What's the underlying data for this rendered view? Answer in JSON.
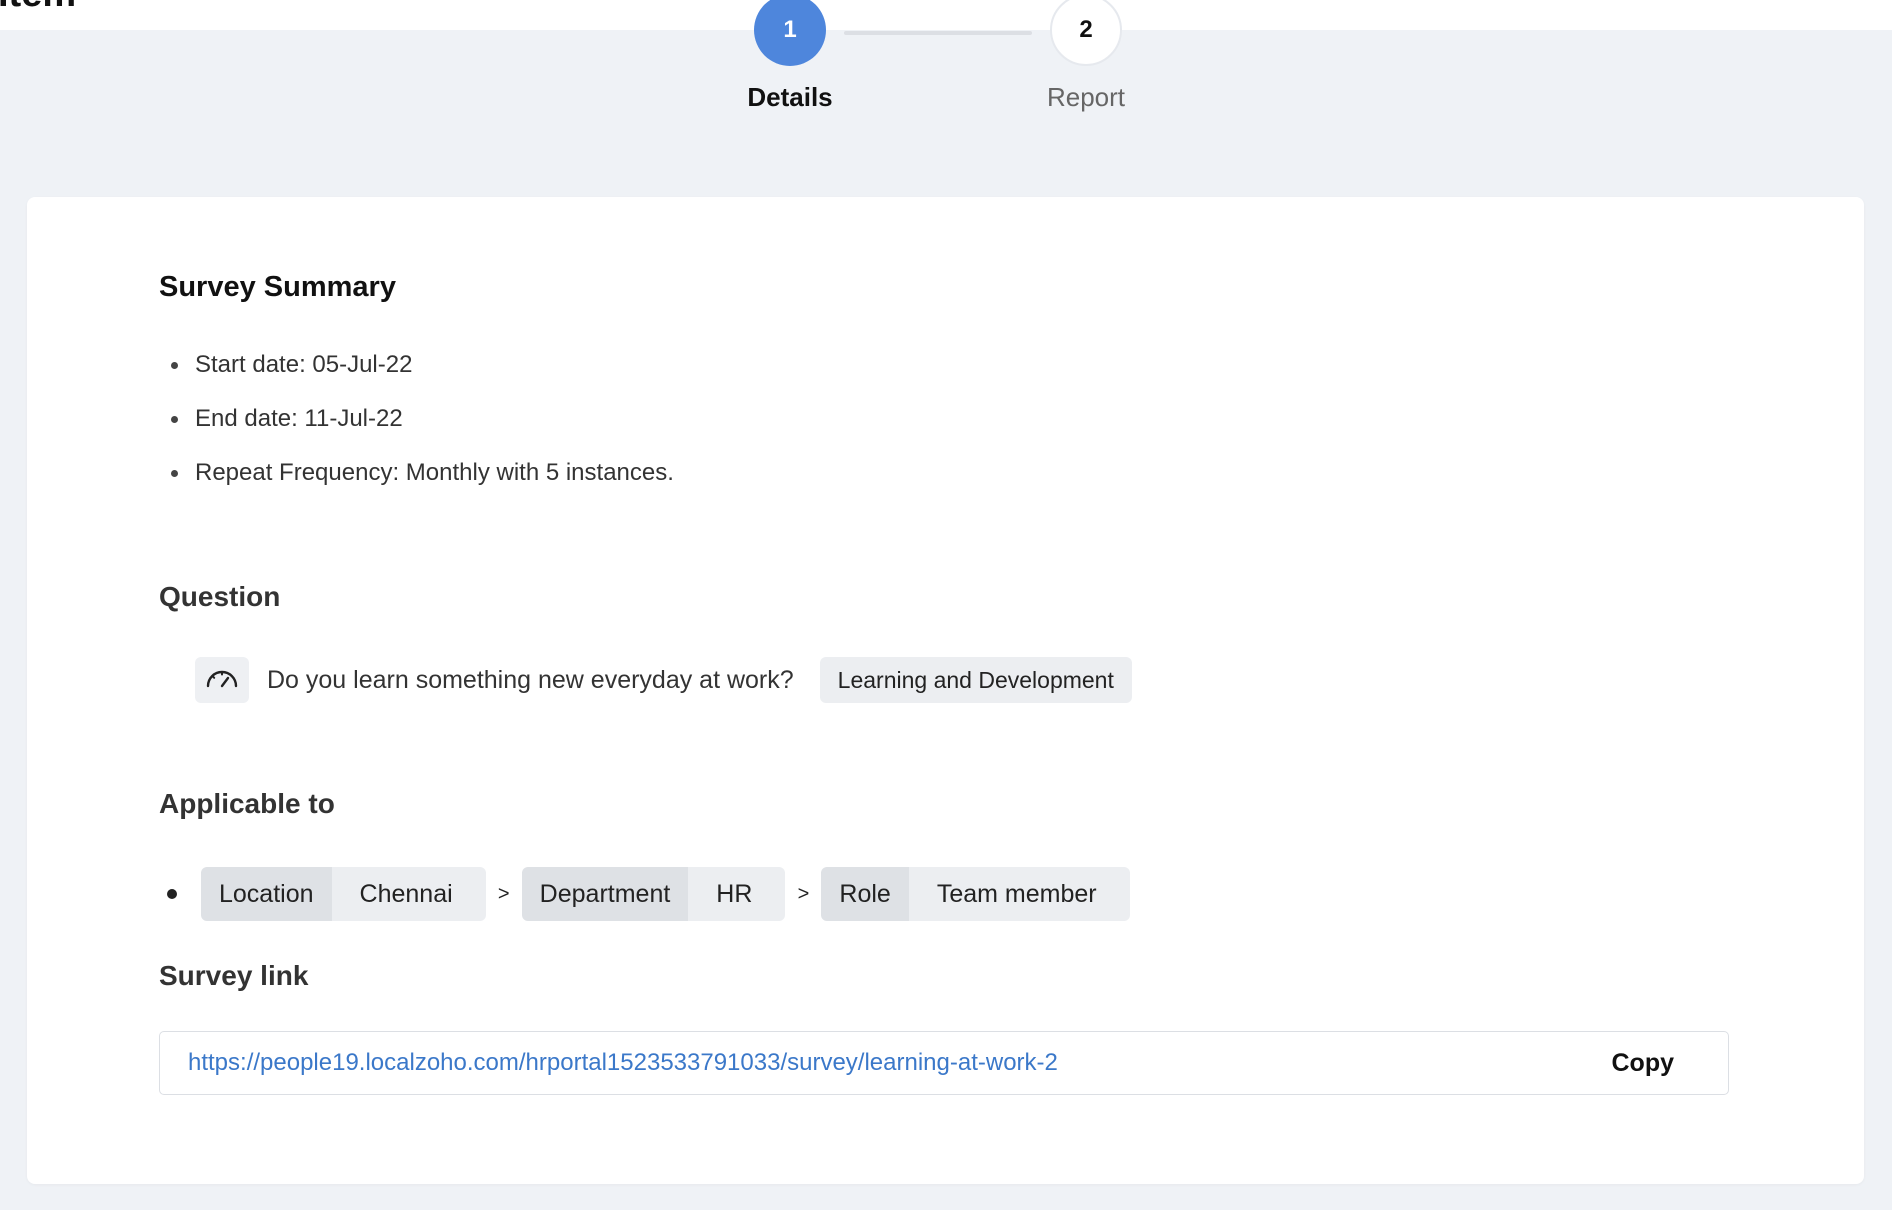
{
  "header": {
    "title": "Item"
  },
  "stepper": {
    "steps": [
      {
        "number": "1",
        "label": "Details"
      },
      {
        "number": "2",
        "label": "Report"
      }
    ]
  },
  "summary": {
    "title": "Survey Summary",
    "items": [
      "Start date: 05-Jul-22",
      "End date: 11-Jul-22",
      "Repeat Frequency: Monthly with 5 instances."
    ]
  },
  "question": {
    "title": "Question",
    "icon": "gauge-icon",
    "text": "Do you learn something new everyday at work?",
    "tag": "Learning and Development"
  },
  "applicable": {
    "title": "Applicable to",
    "separator": ">",
    "criteria": [
      {
        "key": "Location",
        "value": "Chennai"
      },
      {
        "key": "Department",
        "value": "HR"
      },
      {
        "key": "Role",
        "value": "Team member"
      }
    ]
  },
  "survey_link": {
    "title": "Survey link",
    "url": "https://people19.localzoho.com/hrportal1523533791033/survey/learning-at-work-2",
    "copy_label": "Copy"
  },
  "colors": {
    "accent": "#4e86dc",
    "link": "#3b78c9",
    "background": "#eff2f6"
  }
}
